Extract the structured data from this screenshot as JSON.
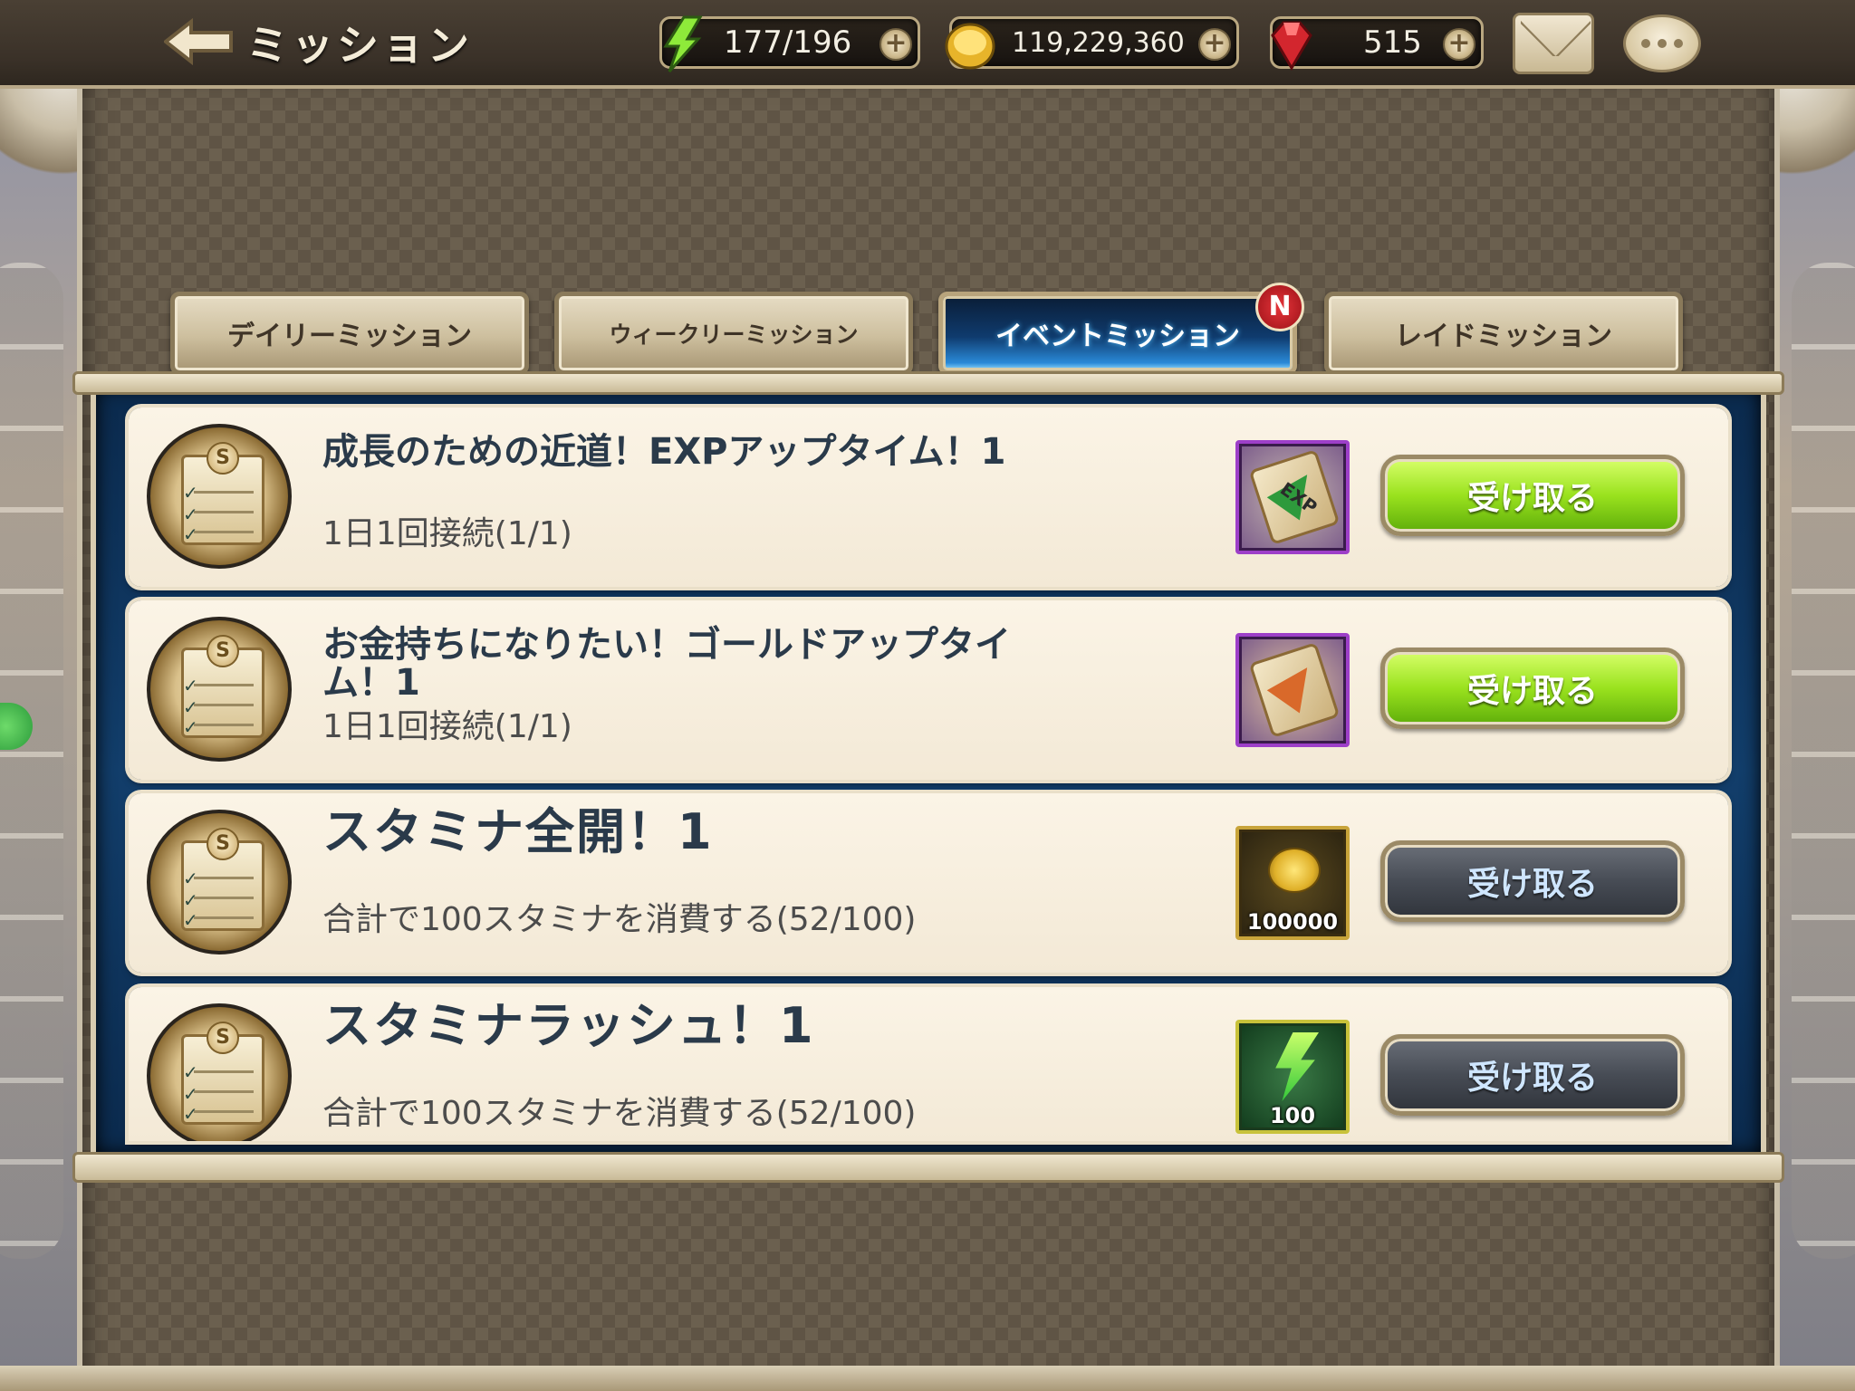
{
  "header": {
    "title": "ミッション",
    "stamina": "177/196",
    "gold": "119,229,360",
    "gems": "515"
  },
  "tabs": [
    {
      "label": "デイリーミッション",
      "active": false
    },
    {
      "label": "ウィークリーミッション",
      "active": false
    },
    {
      "label": "イベントミッション",
      "active": true,
      "badge": "N"
    },
    {
      "label": "レイドミッション",
      "active": false
    }
  ],
  "missions": [
    {
      "title": "成長のための近道！EXPアップタイム！1",
      "desc": "1日1回接続(1/1)",
      "reward": {
        "type": "exp-scroll",
        "label": "EXP",
        "qty": ""
      },
      "button": {
        "label": "受け取る",
        "enabled": true
      }
    },
    {
      "title": "お金持ちになりたい！ゴールドアップタイム！1",
      "desc": "1日1回接続(1/1)",
      "reward": {
        "type": "gold-scroll",
        "qty": ""
      },
      "button": {
        "label": "受け取る",
        "enabled": true
      }
    },
    {
      "title": "スタミナ全開！1",
      "desc": "合計で100スタミナを消費する(52/100)",
      "reward": {
        "type": "gold",
        "qty": "100000"
      },
      "button": {
        "label": "受け取る",
        "enabled": false
      }
    },
    {
      "title": "スタミナラッシュ！1",
      "desc": "合計で100スタミナを消費する(52/100)",
      "reward": {
        "type": "stamina",
        "qty": "100"
      },
      "button": {
        "label": "受け取る",
        "enabled": false
      }
    }
  ],
  "colors": {
    "claim_enabled": "#9ae21e",
    "claim_disabled": "#474c55",
    "active_tab": "#0f3b6e",
    "title_text": "#2a3a4a"
  },
  "icons": {
    "back": "back-arrow-icon",
    "stamina": "lightning-icon",
    "gold": "coin-icon",
    "gems": "ruby-icon",
    "mail": "envelope-icon",
    "chat": "chat-bubble-icon",
    "mission": "mission-scroll-icon"
  }
}
